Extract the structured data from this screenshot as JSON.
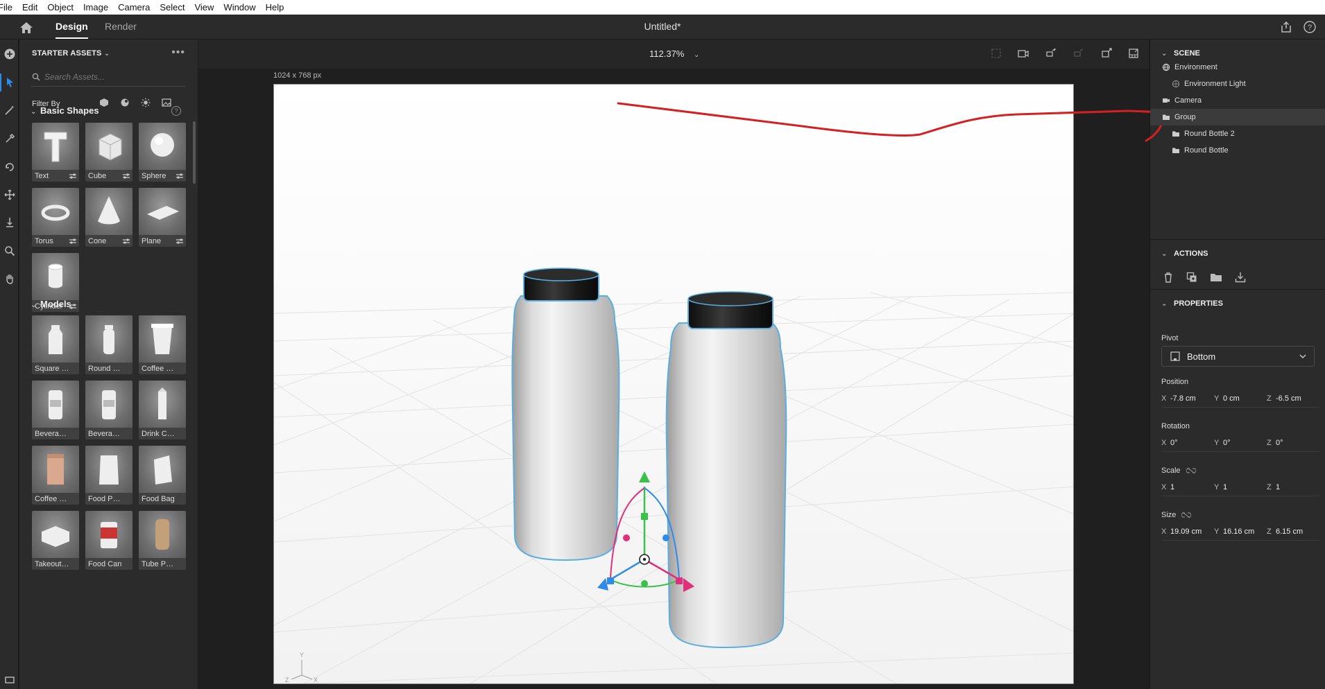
{
  "menu": [
    "File",
    "Edit",
    "Object",
    "Image",
    "Camera",
    "Select",
    "View",
    "Window",
    "Help"
  ],
  "appbar": {
    "tabs": [
      "Design",
      "Render"
    ],
    "title": "Untitled*"
  },
  "assets": {
    "header": "STARTER ASSETS",
    "search_placeholder": "Search Assets...",
    "filter_label": "Filter By",
    "basic_shapes_title": "Basic Shapes",
    "basic_shapes": [
      {
        "label": "Text",
        "icon": "text-3d"
      },
      {
        "label": "Cube",
        "icon": "cube"
      },
      {
        "label": "Sphere",
        "icon": "sphere"
      },
      {
        "label": "Torus",
        "icon": "torus"
      },
      {
        "label": "Cone",
        "icon": "cone"
      },
      {
        "label": "Plane",
        "icon": "plane"
      },
      {
        "label": "Cylinder",
        "icon": "cylinder"
      }
    ],
    "models_title": "Models",
    "models": [
      {
        "label": "Square Bo...",
        "icon": "square-bottle"
      },
      {
        "label": "Round Bo...",
        "icon": "round-bottle"
      },
      {
        "label": "Coffee Cup",
        "icon": "coffee-cup"
      },
      {
        "label": "Beverage ...",
        "icon": "beverage-can"
      },
      {
        "label": "Beverage ...",
        "icon": "beverage-can-2"
      },
      {
        "label": "Drink Cart...",
        "icon": "drink-carton"
      },
      {
        "label": "Coffee Bag",
        "icon": "coffee-bag"
      },
      {
        "label": "Food Pouch",
        "icon": "food-pouch"
      },
      {
        "label": "Food Bag",
        "icon": "food-bag"
      },
      {
        "label": "Takeout Box",
        "icon": "takeout-box"
      },
      {
        "label": "Food Can",
        "icon": "food-can"
      },
      {
        "label": "Tube Pack...",
        "icon": "tube-pack"
      }
    ]
  },
  "viewport": {
    "zoom": "112.37%",
    "dimensions": "1024 x 768 px",
    "axis_labels": {
      "y": "Y",
      "x": "X",
      "z": "Z"
    }
  },
  "scene": {
    "header": "SCENE",
    "items": [
      {
        "label": "Environment",
        "icon": "environment-icon",
        "indent": 0
      },
      {
        "label": "Environment Light",
        "icon": "light-icon",
        "indent": 1
      },
      {
        "label": "Camera",
        "icon": "camera-icon",
        "indent": 0
      },
      {
        "label": "Group",
        "icon": "folder-icon",
        "indent": 0,
        "selected": true
      },
      {
        "label": "Round Bottle 2",
        "icon": "folder-icon",
        "indent": 1
      },
      {
        "label": "Round Bottle",
        "icon": "folder-icon",
        "indent": 1
      }
    ]
  },
  "actions": {
    "header": "ACTIONS",
    "items": [
      "delete",
      "duplicate",
      "group",
      "download"
    ]
  },
  "properties": {
    "header": "PROPERTIES",
    "pivot_label": "Pivot",
    "pivot_value": "Bottom",
    "position_label": "Position",
    "position": {
      "x": "-7.8 cm",
      "y": "0 cm",
      "z": "-6.5 cm"
    },
    "rotation_label": "Rotation",
    "rotation": {
      "x": "0°",
      "y": "0°",
      "z": "0°"
    },
    "scale_label": "Scale",
    "scale": {
      "x": "1",
      "y": "1",
      "z": "1"
    },
    "size_label": "Size",
    "size": {
      "x": "19.09 cm",
      "y": "16.16 cm",
      "z": "6.15 cm"
    }
  },
  "colors": {
    "accent": "#2d8ceb",
    "annotation": "#d42020",
    "selection": "#5aaee0"
  }
}
